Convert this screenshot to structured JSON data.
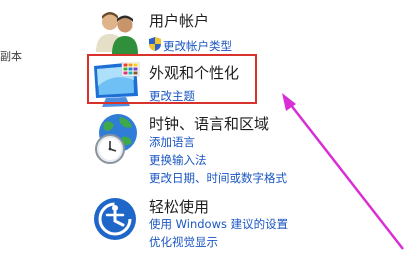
{
  "edge": {
    "label": "副本"
  },
  "categories": {
    "accounts": {
      "title": "用户帐户",
      "links": [
        "更改帐户类型"
      ]
    },
    "appearance": {
      "title": "外观和个性化",
      "links": [
        "更改主题"
      ]
    },
    "clock": {
      "title": "时钟、语言和区域",
      "links": [
        "添加语言",
        "更换输入法",
        "更改日期、时间或数字格式"
      ]
    },
    "access": {
      "title": "轻松使用",
      "links": [
        "使用 Windows 建议的设置",
        "优化视觉显示"
      ]
    }
  },
  "colors": {
    "link": "#1a56c2",
    "highlight_border": "#d9322c",
    "arrow": "#d92ed6"
  },
  "icons": {
    "accounts": "users-icon",
    "appearance": "monitor-palette-icon",
    "clock": "globe-clock-icon",
    "access": "ease-of-access-icon",
    "shield": "uac-shield-icon"
  }
}
